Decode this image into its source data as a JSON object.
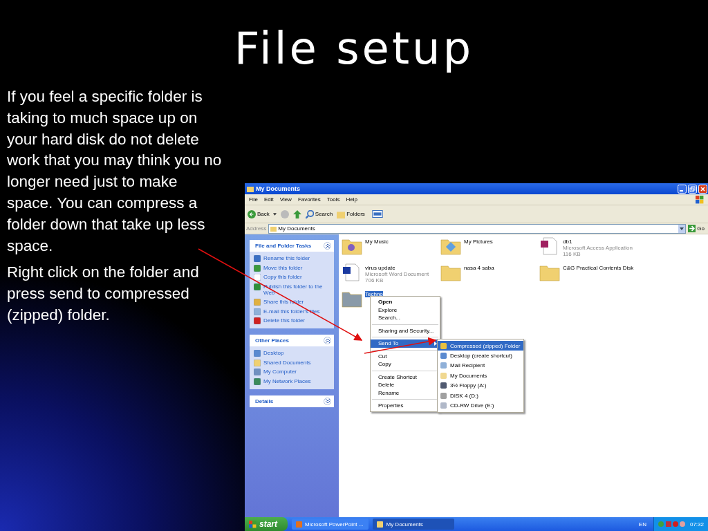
{
  "slide": {
    "title": "File setup",
    "paragraphs": [
      "If you feel a specific folder is taking to much space up on your hard disk do not delete work that you may think you no longer need just to make space. You can compress a folder down that take up less space.",
      "Right click on the folder and press send to compressed (zipped) folder."
    ]
  },
  "window": {
    "title": "My Documents",
    "menu": [
      "File",
      "Edit",
      "View",
      "Favorites",
      "Tools",
      "Help"
    ],
    "toolbar": {
      "back": "Back",
      "search": "Search",
      "folders": "Folders"
    },
    "address": {
      "label": "Address",
      "value": "My Documents",
      "go": "Go"
    }
  },
  "sidebar": [
    {
      "title": "File and Folder Tasks",
      "expanded": true,
      "items": [
        {
          "label": "Rename this folder",
          "kind": "rename"
        },
        {
          "label": "Move this folder",
          "kind": "move"
        },
        {
          "label": "Copy this folder",
          "kind": "copy"
        },
        {
          "label": "Publish this folder to the Web",
          "kind": "web"
        },
        {
          "label": "Share this folder",
          "kind": "share"
        },
        {
          "label": "E-mail this folder's files",
          "kind": "mail"
        },
        {
          "label": "Delete this folder",
          "kind": "delete"
        }
      ]
    },
    {
      "title": "Other Places",
      "expanded": true,
      "items": [
        {
          "label": "Desktop",
          "kind": "desktop"
        },
        {
          "label": "Shared Documents",
          "kind": "folder"
        },
        {
          "label": "My Computer",
          "kind": "computer"
        },
        {
          "label": "My Network Places",
          "kind": "network"
        }
      ]
    },
    {
      "title": "Details",
      "expanded": false
    }
  ],
  "files": [
    {
      "name": "My Music",
      "kind": "music",
      "selected": false
    },
    {
      "name": "My Pictures",
      "kind": "pictures",
      "selected": false
    },
    {
      "name": "db1",
      "type": "Microsoft Access Application",
      "size": "116 KB",
      "kind": "access",
      "selected": false
    },
    {
      "name": "virus update",
      "type": "Microsoft Word Document",
      "size": "706 KB",
      "kind": "word",
      "selected": false
    },
    {
      "name": "nasa 4 saba",
      "kind": "folder",
      "selected": false
    },
    {
      "name": "C&G Practical Contents Disk",
      "kind": "folder",
      "selected": false
    },
    {
      "name": "Techno",
      "kind": "folder",
      "selected": true
    }
  ],
  "context_menu": [
    [
      {
        "label": "Open",
        "default": true,
        "selected": false,
        "submenu": false
      },
      {
        "label": "Explore",
        "default": false,
        "selected": false,
        "submenu": false
      },
      {
        "label": "Search...",
        "default": false,
        "selected": false,
        "submenu": false
      }
    ],
    [
      {
        "label": "Sharing and Security...",
        "default": false,
        "selected": false,
        "submenu": false
      }
    ],
    [
      {
        "label": "Send To",
        "default": false,
        "selected": true,
        "submenu": true
      }
    ],
    [
      {
        "label": "Cut",
        "default": false,
        "selected": false,
        "submenu": false
      },
      {
        "label": "Copy",
        "default": false,
        "selected": false,
        "submenu": false
      }
    ],
    [
      {
        "label": "Create Shortcut",
        "default": false,
        "selected": false,
        "submenu": false
      },
      {
        "label": "Delete",
        "default": false,
        "selected": false,
        "submenu": false
      },
      {
        "label": "Rename",
        "default": false,
        "selected": false,
        "submenu": false
      }
    ],
    [
      {
        "label": "Properties",
        "default": false,
        "selected": false,
        "submenu": false
      }
    ]
  ],
  "send_to": [
    {
      "label": "Compressed (zipped) Folder",
      "kind": "zip",
      "selected": true
    },
    {
      "label": "Desktop (create shortcut)",
      "kind": "desktop",
      "selected": false
    },
    {
      "label": "Mail Recipient",
      "kind": "mail",
      "selected": false
    },
    {
      "label": "My Documents",
      "kind": "documents",
      "selected": false
    },
    {
      "label": "3½ Floppy (A:)",
      "kind": "floppy",
      "selected": false
    },
    {
      "label": "DISK 4 (D:)",
      "kind": "disk",
      "selected": false
    },
    {
      "label": "CD-RW Drive (E:)",
      "kind": "cd",
      "selected": false
    }
  ],
  "taskbar": {
    "start": "start",
    "tasks": [
      {
        "label": "Microsoft PowerPoint ...",
        "kind": "powerpoint",
        "selected": false
      },
      {
        "label": "My Documents",
        "kind": "folder",
        "selected": true
      }
    ],
    "language": "EN",
    "time": "07:32"
  }
}
